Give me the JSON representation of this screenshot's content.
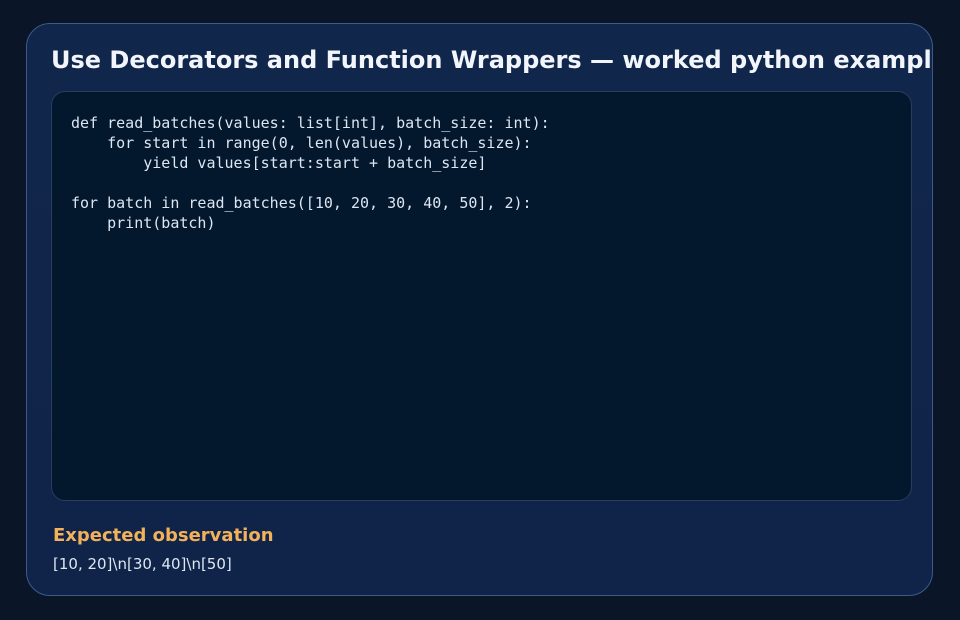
{
  "title": "Use Decorators and Function Wrappers — worked python example",
  "code": "def read_batches(values: list[int], batch_size: int):\n    for start in range(0, len(values), batch_size):\n        yield values[start:start + batch_size]\n\nfor batch in read_batches([10, 20, 30, 40, 50], 2):\n    print(batch)",
  "observation": {
    "heading": "Expected observation",
    "value": "[10, 20]\\n[30, 40]\\n[50]"
  },
  "colors": {
    "background": "#0a1528",
    "card": "#10264a",
    "card_border": "#3c5a8c",
    "code_background": "#03172d",
    "title_text": "#f2f6fc",
    "accent": "#f2b15a",
    "body_text": "#dde6f2"
  }
}
